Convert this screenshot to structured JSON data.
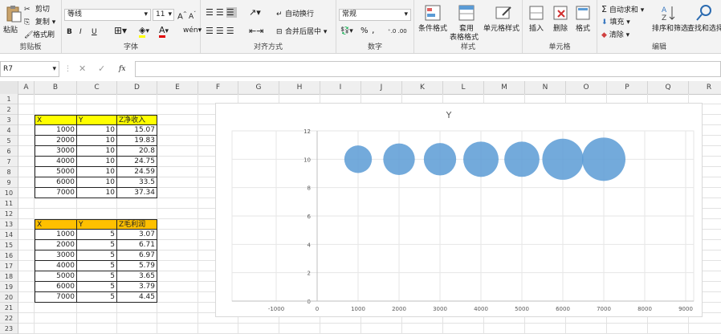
{
  "ribbon": {
    "clipboard": {
      "paste": "粘贴",
      "cut": "剪切",
      "copy": "复制",
      "format_painter": "格式刷",
      "label": "剪贴板"
    },
    "font": {
      "name": "等线",
      "size": "11",
      "bold": "B",
      "italic": "I",
      "underline": "U",
      "label": "字体"
    },
    "alignment": {
      "wrap": "自动换行",
      "merge": "合并后居中",
      "label": "对齐方式"
    },
    "number": {
      "format": "常规",
      "percent": "%",
      "comma": ",",
      "label": "数字"
    },
    "styles": {
      "conditional": "条件格式",
      "table_format_1": "套用",
      "table_format_2": "表格格式",
      "cell_styles": "单元格样式",
      "label": "样式"
    },
    "cells": {
      "insert": "插入",
      "delete": "删除",
      "format": "格式",
      "label": "单元格"
    },
    "editing": {
      "autosum": "自动求和",
      "fill": "填充",
      "clear": "清除",
      "sort": "排序和筛选",
      "find": "查找和选择",
      "label": "编辑"
    }
  },
  "formula_bar": {
    "name_box": "R7",
    "fx": "fx",
    "value": ""
  },
  "columns": [
    "A",
    "B",
    "C",
    "D",
    "E",
    "F",
    "G",
    "H",
    "I",
    "J",
    "K",
    "L",
    "M",
    "N",
    "O",
    "P",
    "Q",
    "R"
  ],
  "rows": [
    "1",
    "2",
    "3",
    "4",
    "5",
    "6",
    "7",
    "8",
    "9",
    "10",
    "11",
    "12",
    "13",
    "14",
    "15",
    "16",
    "17",
    "18",
    "19",
    "20",
    "21",
    "22",
    "23"
  ],
  "table1": {
    "headers": [
      "X",
      "Y",
      "Z净收入"
    ],
    "rows": [
      [
        "1000",
        "10",
        "15.07"
      ],
      [
        "2000",
        "10",
        "19.83"
      ],
      [
        "3000",
        "10",
        "20.8"
      ],
      [
        "4000",
        "10",
        "24.75"
      ],
      [
        "5000",
        "10",
        "24.59"
      ],
      [
        "6000",
        "10",
        "33.5"
      ],
      [
        "7000",
        "10",
        "37.34"
      ]
    ],
    "header_color": "#ffff00"
  },
  "table2": {
    "headers": [
      "X",
      "Y",
      "Z毛利润"
    ],
    "rows": [
      [
        "1000",
        "5",
        "3.07"
      ],
      [
        "2000",
        "5",
        "6.71"
      ],
      [
        "3000",
        "5",
        "6.97"
      ],
      [
        "4000",
        "5",
        "5.79"
      ],
      [
        "5000",
        "5",
        "3.65"
      ],
      [
        "6000",
        "5",
        "3.79"
      ],
      [
        "7000",
        "5",
        "4.45"
      ]
    ],
    "header_color": "#ffc000"
  },
  "chart_data": {
    "type": "scatter",
    "title": "Y",
    "x": [
      1000,
      2000,
      3000,
      4000,
      5000,
      6000,
      7000
    ],
    "y": [
      10,
      10,
      10,
      10,
      10,
      10,
      10
    ],
    "size": [
      15.07,
      19.83,
      20.8,
      24.75,
      24.59,
      33.5,
      37.34
    ],
    "xlim": [
      -1000,
      9000
    ],
    "ylim": [
      0,
      12
    ],
    "xticks": [
      "-1000",
      "0",
      "1000",
      "2000",
      "3000",
      "4000",
      "5000",
      "6000",
      "7000",
      "8000",
      "9000"
    ],
    "yticks": [
      "0",
      "2",
      "4",
      "6",
      "8",
      "10",
      "12"
    ],
    "grid": true,
    "bubble_color": "#5b9bd5"
  }
}
